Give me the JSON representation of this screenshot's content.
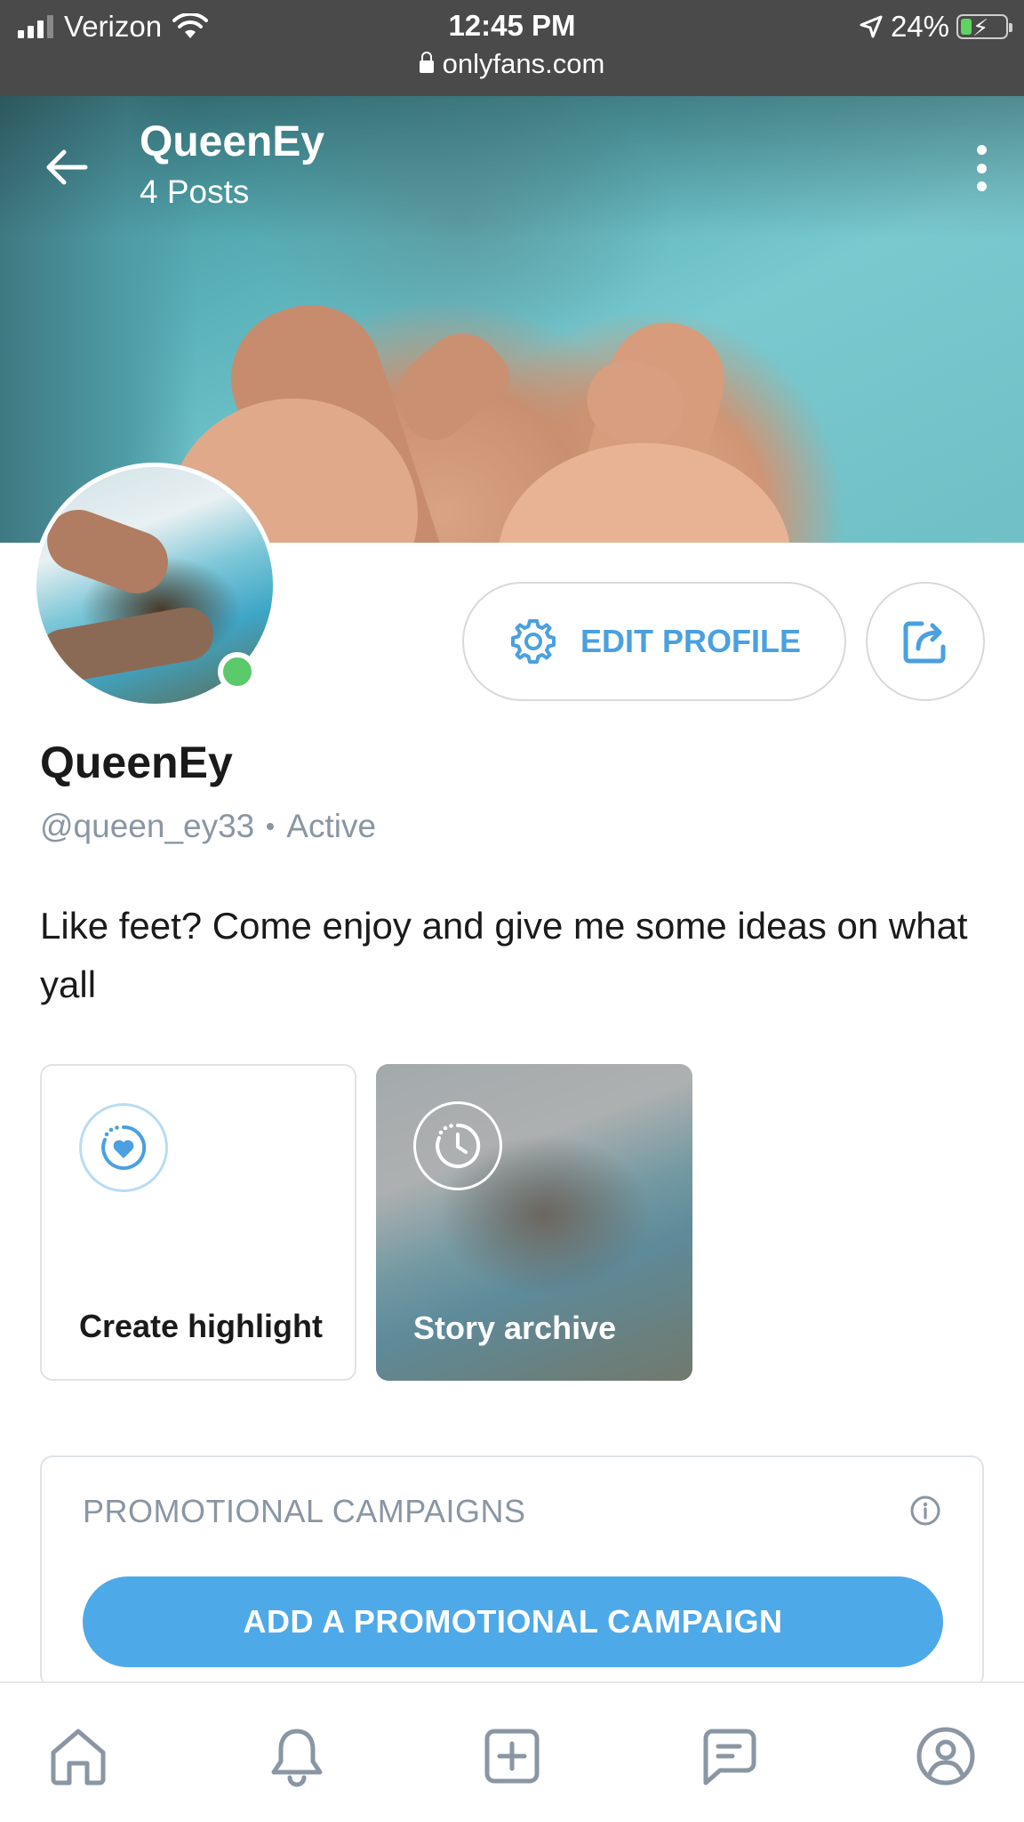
{
  "status_bar": {
    "carrier": "Verizon",
    "time": "12:45 PM",
    "battery": "24%",
    "url": "onlyfans.com"
  },
  "header": {
    "title": "QueenEy",
    "subtitle": "4 Posts"
  },
  "profile": {
    "name": "QueenEy",
    "handle": "@queen_ey33",
    "status": "Active",
    "bio": "Like feet? Come enjoy and give me some ideas on what yall",
    "edit_button": "EDIT PROFILE"
  },
  "highlights": [
    {
      "label": "Create highlight",
      "icon": "heart-progress-icon"
    },
    {
      "label": "Story archive",
      "icon": "clock-history-icon"
    }
  ],
  "promo": {
    "title": "PROMOTIONAL CAMPAIGNS",
    "button": "ADD A PROMOTIONAL CAMPAIGN"
  },
  "bottom_nav": [
    {
      "name": "home-icon"
    },
    {
      "name": "bell-icon"
    },
    {
      "name": "plus-square-icon"
    },
    {
      "name": "chat-icon"
    },
    {
      "name": "profile-icon"
    }
  ],
  "colors": {
    "accent": "#4ea9e8",
    "online": "#5cc96b",
    "muted": "#8a96a3"
  }
}
